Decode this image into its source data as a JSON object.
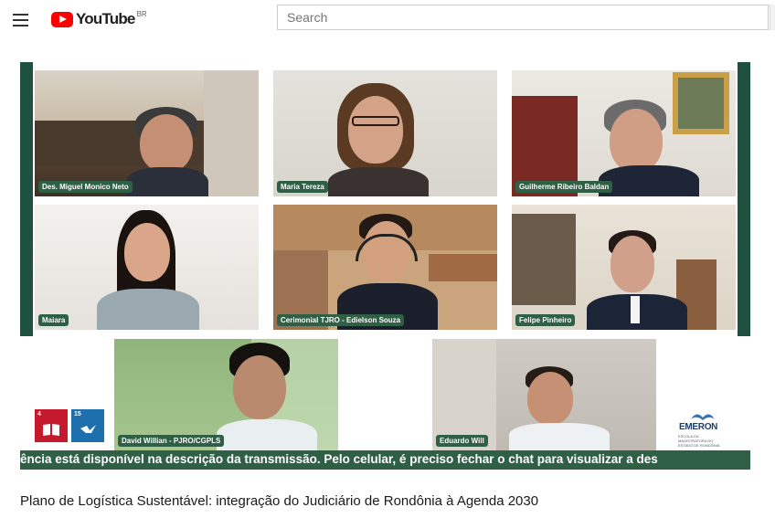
{
  "header": {
    "logo_text": "YouTube",
    "country_code": "BR",
    "search_placeholder": "Search",
    "icons": [
      "menu-icon",
      "youtube-play-icon"
    ]
  },
  "player": {
    "participants": [
      {
        "name": "Des. Miguel Monico Neto"
      },
      {
        "name": "Maria Tereza"
      },
      {
        "name": "Guilherme Ribeiro Baldan"
      },
      {
        "name": "Maiara"
      },
      {
        "name": "Cerimonial TJRO - Edielson Souza"
      },
      {
        "name": "Felipe Pinheiro"
      },
      {
        "name": "David Willian - PJRO/CGPLS"
      },
      {
        "name": "Eduardo Will"
      }
    ],
    "sdg_badges": [
      {
        "number": "4",
        "color": "#c5192d",
        "icon": "book-icon"
      },
      {
        "number": "15",
        "color": "#1e6fae",
        "icon": "bird-icon"
      }
    ],
    "sponsor_logo": "EMERON",
    "sponsor_logo_subtext": "ESCOLA DA MAGISTRATURA DO ESTADO DE RONDÔNIA",
    "ticker_text": "ência está disponível na descrição da transmissão. Pelo celular, é preciso fechar o chat para visualizar a des",
    "colors": {
      "accent_green": "#1f5140",
      "label_green": "#2f5f45"
    }
  },
  "video": {
    "title": "Plano de Logística Sustentável: integração do Judiciário de Rondônia à Agenda 2030"
  }
}
